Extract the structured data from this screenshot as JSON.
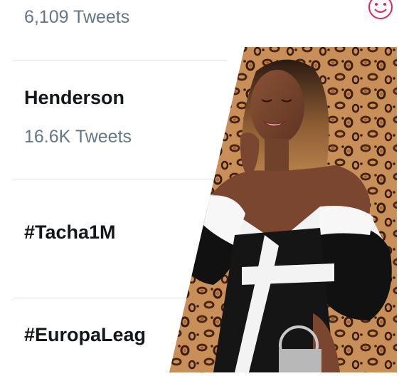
{
  "trends": [
    {
      "title": "",
      "count": "6,109 Tweets"
    },
    {
      "title": "Henderson",
      "count": "16.6K Tweets"
    },
    {
      "title": "#Tacha1M",
      "count": ""
    },
    {
      "title": "#EuropaLeag",
      "count": ""
    }
  ],
  "icons": {
    "emoji": "smiley-face-icon"
  },
  "colors": {
    "title": "#14171a",
    "count": "#657786",
    "divider": "#dfe3e6",
    "emoji": "#e0245e"
  }
}
